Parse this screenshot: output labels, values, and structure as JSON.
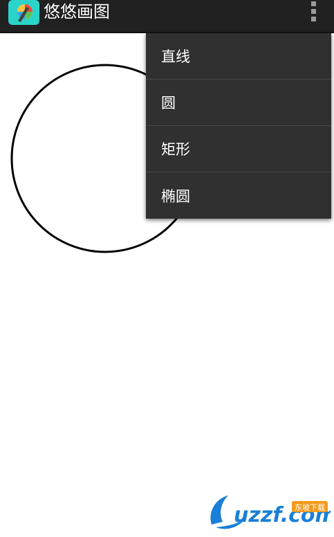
{
  "app": {
    "title": "悠悠画图"
  },
  "menu": {
    "items": [
      {
        "label": "直线"
      },
      {
        "label": "圆"
      },
      {
        "label": "矩形"
      },
      {
        "label": "椭圆"
      }
    ]
  },
  "watermark": {
    "brand": "uzzf.com",
    "tagline": "东坡下载"
  },
  "colors": {
    "action_bar": "#212121",
    "menu_background": "#303030",
    "menu_divider": "#474747",
    "watermark_blue": "#1a7fd6",
    "watermark_orange": "#f29a1d"
  }
}
